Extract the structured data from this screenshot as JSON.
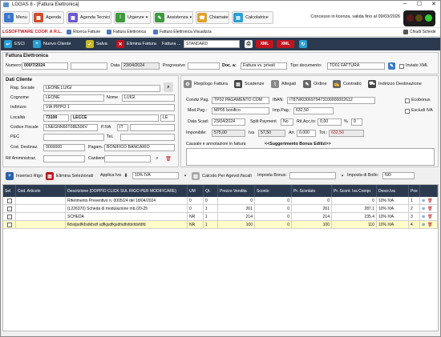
{
  "window": {
    "title": "LGGAS 8 - [Fattura Elettronica]",
    "minimize": "─",
    "maximize": "☐",
    "close": "✕"
  },
  "menu": {
    "items": [
      "Menu",
      "Agenda",
      "Agenda Tecnici",
      "Urgenze",
      "Assistenza",
      "Chiamate",
      "Calcolatrice"
    ],
    "license": "Concesso in licenza, valida fino al 09/03/2026"
  },
  "subbar": {
    "company": "LGSOFTWARE COOP. A R.L.",
    "links": [
      "Ricerca Fatture",
      "Fattura Elettronica",
      "Fattura Elettronica Visualizza"
    ],
    "close_tabs": "Chiudi Schede"
  },
  "toolbar": {
    "exit": "ESCI",
    "new_client": "Nuovo Cliente",
    "save": "Salva",
    "delete_invoice": "Elimina Fattura",
    "invoice_label": "Fattura ...",
    "invoice_type": "STANDARD",
    "xml1": "XML",
    "xml2": "XML"
  },
  "header": {
    "section": "Fattura Elettronica",
    "number_label": "Numero:",
    "number": "000/7/2024",
    "date_label": "Data",
    "date": "23/04/2024",
    "progressive_label": "Progressivo",
    "doc_label": "Doc. a:",
    "doc_value": "Fattura vs. privati",
    "doc_type_label": "Tipo documento:",
    "doc_type": "TD01 FATTURA",
    "xml_sent": "Inviato XML"
  },
  "client": {
    "section": "Dati Cliente",
    "company_label": "Rag. Sociale",
    "company": "LEONE LUIGI",
    "surname_label": "Cognome",
    "surname": "LEONE",
    "name_label": "Nome",
    "name": "LUIGI",
    "address_label": "Indirizzo",
    "address": "VIA PIPPO 1",
    "city_label": "Località",
    "cap": "73100",
    "city": "LECCE",
    "prov": "LE",
    "cf_label": "Codice Fiscale",
    "cf": "LNEGNN66T08E506V",
    "piva_label": "P.IVA",
    "country": "IT",
    "pec_label": "PEC",
    "tel_label": "Tel.",
    "dest_label": "Cod. Destinaz.",
    "dest": "0000000",
    "pay_label": "Pagam.:",
    "pay": "BONIFICO BANCARIO",
    "admin_label": "Rif Amministraz.",
    "site_label": "Cantiere"
  },
  "actions": {
    "summary": "Riepilogo Fattura",
    "schedule": "Scadenze",
    "attachments": "Allegati",
    "orders": "Ordine",
    "contracts": "Contratto",
    "shipping": "Indirizzo Destinazione"
  },
  "payment": {
    "cond_label": "Condiz Pag.",
    "cond": "TP02 PAGAMENTO COM",
    "iban_label": "IBAN:",
    "iban": "IT87W0306979473100000002612",
    "mode_label": "Mod.Pag.:",
    "mode": "MP05 bonifico",
    "imp_label": "Imp.Pag.:",
    "imp": "632,50",
    "due_label": "Data Scad:",
    "due": "23/04/2024",
    "split_label": "Split Payment",
    "split": "No",
    "rit_label": "Rit.Acc.to:",
    "rit": "0,00",
    "percent": "%",
    "pct": "0",
    "taxable_label": "Imponibile:",
    "taxable": "575,00",
    "vat_label": "Iva",
    "vat": "57,50",
    "rounding_label": "Arr.",
    "rounding": "0,000",
    "total_label": "Tot.:",
    "total": "632,50",
    "eco": "Ecobonus",
    "exvat": "Escludi IVA",
    "notes_label": "Causale e annotazioni in fattura",
    "notes_hint": "<<Suggerimento Bonus Edilizi>>"
  },
  "rowtools": {
    "insert": "Inserisci Rigo",
    "delete": "Elimina Selezionati",
    "apply_vat": "Applica Iva",
    "vat": "10% IVA",
    "calc": "Calcolo Per Agevol.fiscali",
    "bonus_label": "Imposta Bonus:",
    "stamp_label": "Imposta di Bollo:",
    "stamp": "NO"
  },
  "grid": {
    "headers": [
      "Sel",
      "Cod. Articolo",
      "Descrizione (DOPPIO CLICK SUL RIGO PER MODIFICARE)",
      "UM",
      "Qt.",
      "Prezzo Vendita",
      "Sconto",
      "Pr. Scontato",
      "Pr. Scont. Iva Compr.",
      "Descr.Iva",
      "Pos",
      ""
    ],
    "rows": [
      {
        "code": "",
        "desc": "Riferimento Preventivo n. 0005/24 del 18/04/2024",
        "um": "0",
        "qty": "0",
        "price": "0",
        "disc": "0",
        "net": "0",
        "gross": "0",
        "vat": "10% IVA",
        "pos": "1"
      },
      {
        "code": "",
        "desc": "(L226370) Scheda di modulazione mb./20-25",
        "um": "0",
        "qty": "1",
        "price": "261",
        "disc": "0",
        "net": "261",
        "gross": "287.1",
        "vat": "10% IVA",
        "pos": "2"
      },
      {
        "code": "",
        "desc": "SCHEDA",
        "um": "NR",
        "qty": "1",
        "price": "214",
        "disc": "0",
        "net": "214",
        "gross": "235.4",
        "vat": "10% IVA",
        "pos": "3"
      },
      {
        "code": "",
        "desc": "fkfsdjsdfkfsdkfsdf sdfkjsdfkjsdfsdfsfdsfdsfdfd",
        "um": "NR",
        "qty": "1",
        "price": "100",
        "disc": "0",
        "net": "100",
        "gross": "110",
        "vat": "10% IVA",
        "pos": "4"
      }
    ]
  },
  "colors": {
    "navy": "#2b3a4f",
    "highlight": "#fffcc8",
    "red": "#c0141e"
  }
}
